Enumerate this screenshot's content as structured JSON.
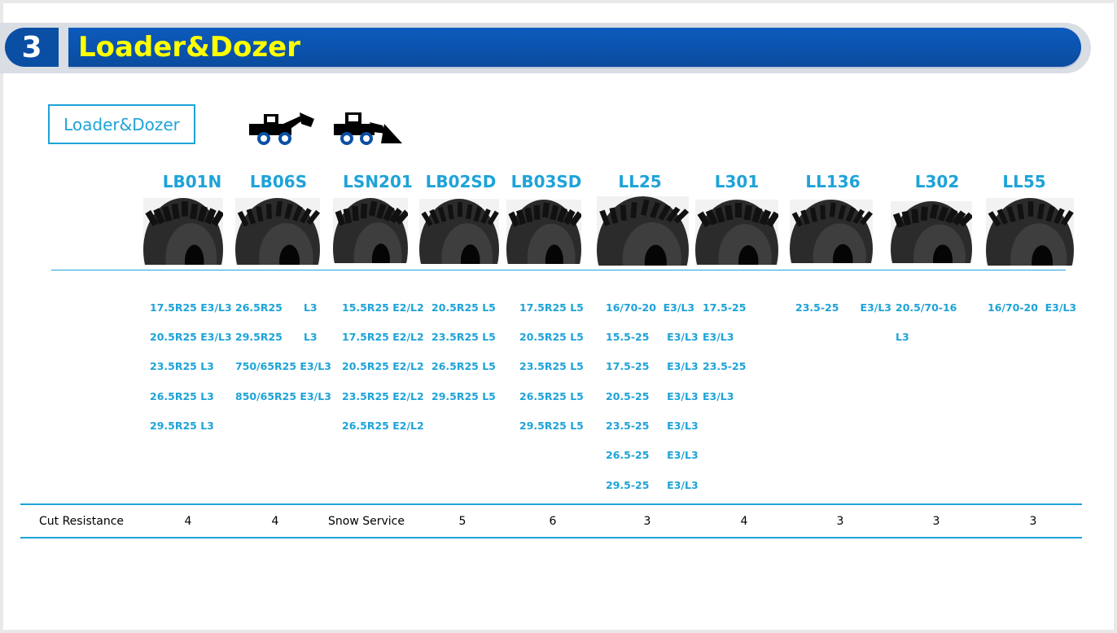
{
  "banner": {
    "number": "3",
    "title": "Loader&Dozer"
  },
  "category_tag": "Loader&Dozer",
  "machines": [
    "wheel-loader-icon",
    "dozer-loader-icon"
  ],
  "colors": {
    "accent": "#1ea3d8",
    "banner": "#0a4fa3",
    "title": "#ffff00"
  },
  "models": [
    {
      "name": "LB01N",
      "sizes": [
        "17.5R25 E3/L3",
        "20.5R25 E3/L3",
        "23.5R25 L3",
        "26.5R25 L3",
        "29.5R25 L3"
      ],
      "cut": "4"
    },
    {
      "name": "LB06S",
      "sizes": [
        "26.5R25      L3",
        "29.5R25      L3",
        "750/65R25 E3/L3",
        "850/65R25 E3/L3"
      ],
      "cut": "4"
    },
    {
      "name": "LSN201",
      "sizes": [
        "15.5R25 E2/L2",
        "17.5R25 E2/L2",
        "20.5R25 E2/L2",
        "23.5R25 E2/L2",
        "26.5R25 E2/L2"
      ],
      "cut": "Snow Service"
    },
    {
      "name": "LB02SD",
      "sizes": [
        "20.5R25 L5",
        "23.5R25 L5",
        "26.5R25 L5",
        "29.5R25 L5"
      ],
      "cut": "5"
    },
    {
      "name": "LB03SD",
      "sizes": [
        "17.5R25 L5",
        "20.5R25 L5",
        "23.5R25 L5",
        "26.5R25 L5",
        "29.5R25 L5"
      ],
      "cut": "6"
    },
    {
      "name": "LL25",
      "sizes": [
        "16/70-20  E3/L3",
        "15.5-25     E3/L3",
        "17.5-25     E3/L3",
        "20.5-25     E3/L3",
        "23.5-25     E3/L3",
        "26.5-25     E3/L3",
        "29.5-25     E3/L3"
      ],
      "cut": "3"
    },
    {
      "name": "L301",
      "sizes": [
        "17.5-25",
        "E3/L3",
        "23.5-25",
        "E3/L3"
      ],
      "cut": "4"
    },
    {
      "name": "LL136",
      "sizes": [
        "23.5-25      E3/L3"
      ],
      "cut": "3"
    },
    {
      "name": "L302",
      "sizes": [
        "20.5/70-16",
        "L3"
      ],
      "cut": "3"
    },
    {
      "name": "LL55",
      "sizes": [
        "16/70-20  E3/L3"
      ],
      "cut": "3"
    }
  ],
  "cut_resistance_label": "Cut Resistance"
}
